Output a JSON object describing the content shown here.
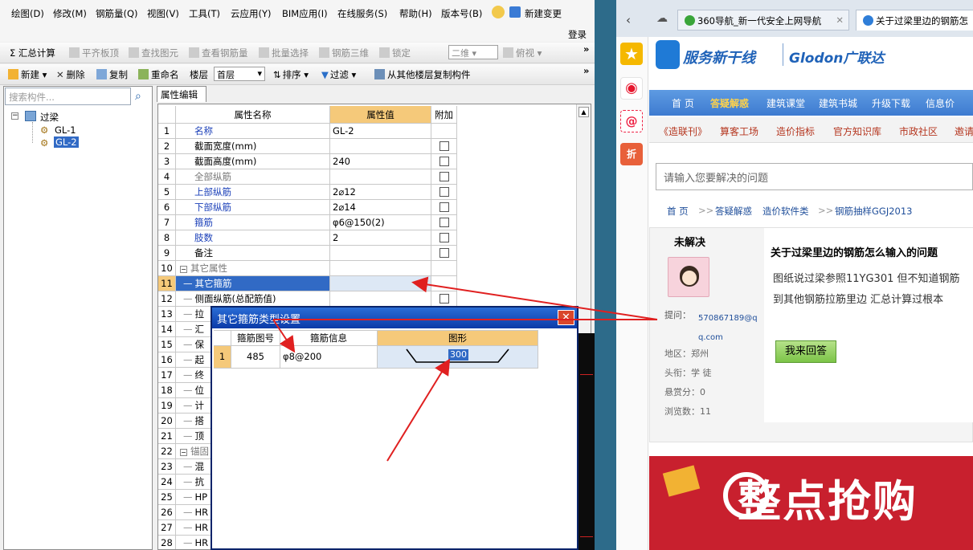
{
  "menubar": {
    "items": [
      "绘图(D)",
      "修改(M)",
      "钢筋量(Q)",
      "视图(V)",
      "工具(T)",
      "云应用(Y)",
      "BIM应用(I)",
      "在线服务(S)",
      "帮助(H)",
      "版本号(B)",
      "新建变更"
    ],
    "login": "登录"
  },
  "toolbar1": {
    "items": [
      "Σ 汇总计算",
      "平齐板顶",
      "查找图元",
      "查看钢筋量",
      "批量选择",
      "钢筋三维",
      "锁定"
    ],
    "view_mode": "二维",
    "view_mode2": "俯视"
  },
  "toolbar2": {
    "items": [
      "新建",
      "删除",
      "复制",
      "重命名",
      "楼层"
    ],
    "floor": "首层",
    "sort": "排序",
    "filter": "过滤",
    "copy_from": "从其他楼层复制构件"
  },
  "tree": {
    "search_placeholder": "搜索构件...",
    "root": "过梁",
    "children": [
      "GL-1",
      "GL-2"
    ]
  },
  "property_editor": {
    "tab": "属性编辑",
    "headers": [
      "属性名称",
      "属性值",
      "附加"
    ],
    "rows": [
      {
        "n": "1",
        "name": "名称",
        "value": "GL-2",
        "chk": false
      },
      {
        "n": "2",
        "name": "截面宽度(mm)",
        "value": "",
        "chk": true
      },
      {
        "n": "3",
        "name": "截面高度(mm)",
        "value": "240",
        "chk": true
      },
      {
        "n": "4",
        "name": "全部纵筋",
        "value": "",
        "chk": true
      },
      {
        "n": "5",
        "name": "上部纵筋",
        "value": "2⌀12",
        "chk": true
      },
      {
        "n": "6",
        "name": "下部纵筋",
        "value": "2⌀14",
        "chk": true
      },
      {
        "n": "7",
        "name": "箍筋",
        "value": "φ6@150(2)",
        "chk": true
      },
      {
        "n": "8",
        "name": "肢数",
        "value": "2",
        "chk": true
      },
      {
        "n": "9",
        "name": "备注",
        "value": "",
        "chk": true
      },
      {
        "n": "10",
        "name": "其它属性",
        "value": "",
        "chk": false
      },
      {
        "n": "11",
        "name": "其它箍筋",
        "value": "",
        "chk": false
      },
      {
        "n": "12",
        "name": "侧面纵筋(总配筋值)",
        "value": "",
        "chk": true
      },
      {
        "n": "13",
        "name": "拉",
        "value": "",
        "chk": false
      },
      {
        "n": "14",
        "name": "汇",
        "value": "",
        "chk": false
      },
      {
        "n": "15",
        "name": "保",
        "value": "",
        "chk": false
      },
      {
        "n": "16",
        "name": "起",
        "value": "",
        "chk": false
      },
      {
        "n": "17",
        "name": "终",
        "value": "",
        "chk": false
      },
      {
        "n": "18",
        "name": "位",
        "value": "",
        "chk": false
      },
      {
        "n": "19",
        "name": "计",
        "value": "",
        "chk": false
      },
      {
        "n": "20",
        "name": "搭",
        "value": "",
        "chk": false
      },
      {
        "n": "21",
        "name": "顶",
        "value": "",
        "chk": false
      },
      {
        "n": "22",
        "name": "锚固",
        "value": "",
        "chk": false
      },
      {
        "n": "23",
        "name": "混",
        "value": "",
        "chk": false
      },
      {
        "n": "24",
        "name": "抗",
        "value": "",
        "chk": false
      },
      {
        "n": "25",
        "name": "HP",
        "value": "",
        "chk": false
      },
      {
        "n": "26",
        "name": "HR",
        "value": "",
        "chk": false
      },
      {
        "n": "27",
        "name": "HR",
        "value": "",
        "chk": false
      },
      {
        "n": "28",
        "name": "HR",
        "value": "",
        "chk": false
      }
    ]
  },
  "dialog": {
    "title": "其它箍筋类型设置",
    "headers": [
      "箍筋图号",
      "箍筋信息",
      "图形"
    ],
    "row": {
      "n": "1",
      "code": "485",
      "info": "φ8@200",
      "shape_value": "300"
    }
  },
  "browser": {
    "tabs": [
      "360导航_新一代安全上网导航",
      "关于过梁里边的钢筋怎"
    ],
    "logo_text": "服务新干线",
    "brand": "Glodon广联达",
    "nav": [
      "首 页",
      "答疑解惑",
      "建筑课堂",
      "建筑书城",
      "升级下载",
      "信息价"
    ],
    "subnav": [
      "《造联刊》",
      "算客工场",
      "造价指标",
      "官方知识库",
      "市政社区",
      "邀请"
    ],
    "search_placeholder": "请输入您要解决的问题",
    "breadcrumb": [
      "首 页",
      ">>",
      "答疑解惑",
      "造价软件类",
      ">>",
      "钢筋抽样GGJ2013"
    ],
    "status": "未解决",
    "question_title": "关于过梁里边的钢筋怎么输入的问题",
    "question_body_1": "图纸说过梁参照11YG301 但不知道钢筋",
    "question_body_2": "到其他钢筋拉筋里边 汇总计算过根本",
    "asker_label": "提问：",
    "asker": "570867189@qq.com",
    "region": "地区：郑州",
    "title_rank": "头衔：学 徒",
    "reward": "悬赏分：0",
    "views": "浏览数：11",
    "answer_button": "我来回答",
    "promo": "整点抢购"
  },
  "colors": {
    "header_orange": "#f5c97a",
    "selected_blue": "#316ac5",
    "arrow_red": "#e02020",
    "nav_blue": "#3d7bd0"
  }
}
